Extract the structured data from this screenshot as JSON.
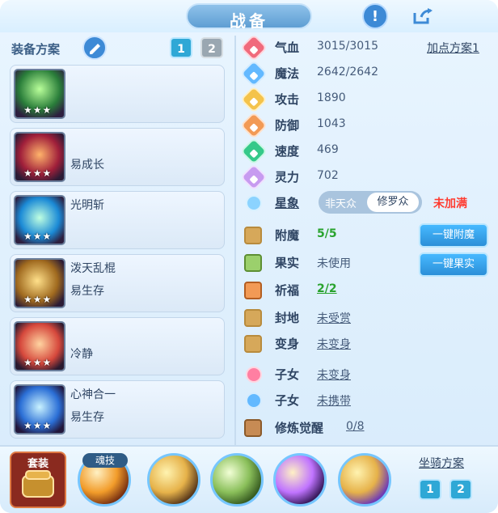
{
  "header": {
    "title": "战备"
  },
  "equipment": {
    "title": "装备方案",
    "schemes": [
      "1",
      "2"
    ],
    "cards": [
      {
        "line1": "",
        "line2": "",
        "stars": "★★★"
      },
      {
        "line1": "",
        "line2": "易成长",
        "stars": "★★★"
      },
      {
        "line1": "光明斩",
        "line2": "",
        "stars": "★★★"
      },
      {
        "line1": "泼天乱棍",
        "line2": "易生存",
        "stars": "★★★"
      },
      {
        "line1": "",
        "line2": "冷静",
        "stars": "★★★"
      },
      {
        "line1": "心神合一",
        "line2": "易生存",
        "stars": "★★★"
      }
    ]
  },
  "stats": {
    "plan_link": "加点方案1",
    "rows": [
      {
        "label": "气血",
        "value": "3015/3015"
      },
      {
        "label": "魔法",
        "value": "2642/2642"
      },
      {
        "label": "攻击",
        "value": "1890"
      },
      {
        "label": "防御",
        "value": "1043"
      },
      {
        "label": "速度",
        "value": "469"
      },
      {
        "label": "灵力",
        "value": "702"
      }
    ],
    "star_label": "星象",
    "toggle_left": "非天众",
    "toggle_right": "修罗众",
    "unfull": "未加满",
    "extras": [
      {
        "label": "附魔",
        "value": "5/5"
      },
      {
        "label": "果实",
        "value": "未使用"
      },
      {
        "label": "祈福",
        "value": "2/2"
      },
      {
        "label": "封地",
        "value": "未受赏"
      },
      {
        "label": "变身",
        "value": "未变身"
      },
      {
        "label": "子女",
        "value": "未变身"
      },
      {
        "label": "子女",
        "value": "未携带"
      },
      {
        "label": "修炼觉醒",
        "value": "0/8"
      }
    ],
    "buttons": {
      "enchant": "一键附魔",
      "fruit": "一键果实"
    }
  },
  "bottom": {
    "set_label": "套装",
    "soul_label": "魂技",
    "mount_title": "坐骑方案",
    "mount_schemes": [
      "1",
      "2"
    ]
  }
}
